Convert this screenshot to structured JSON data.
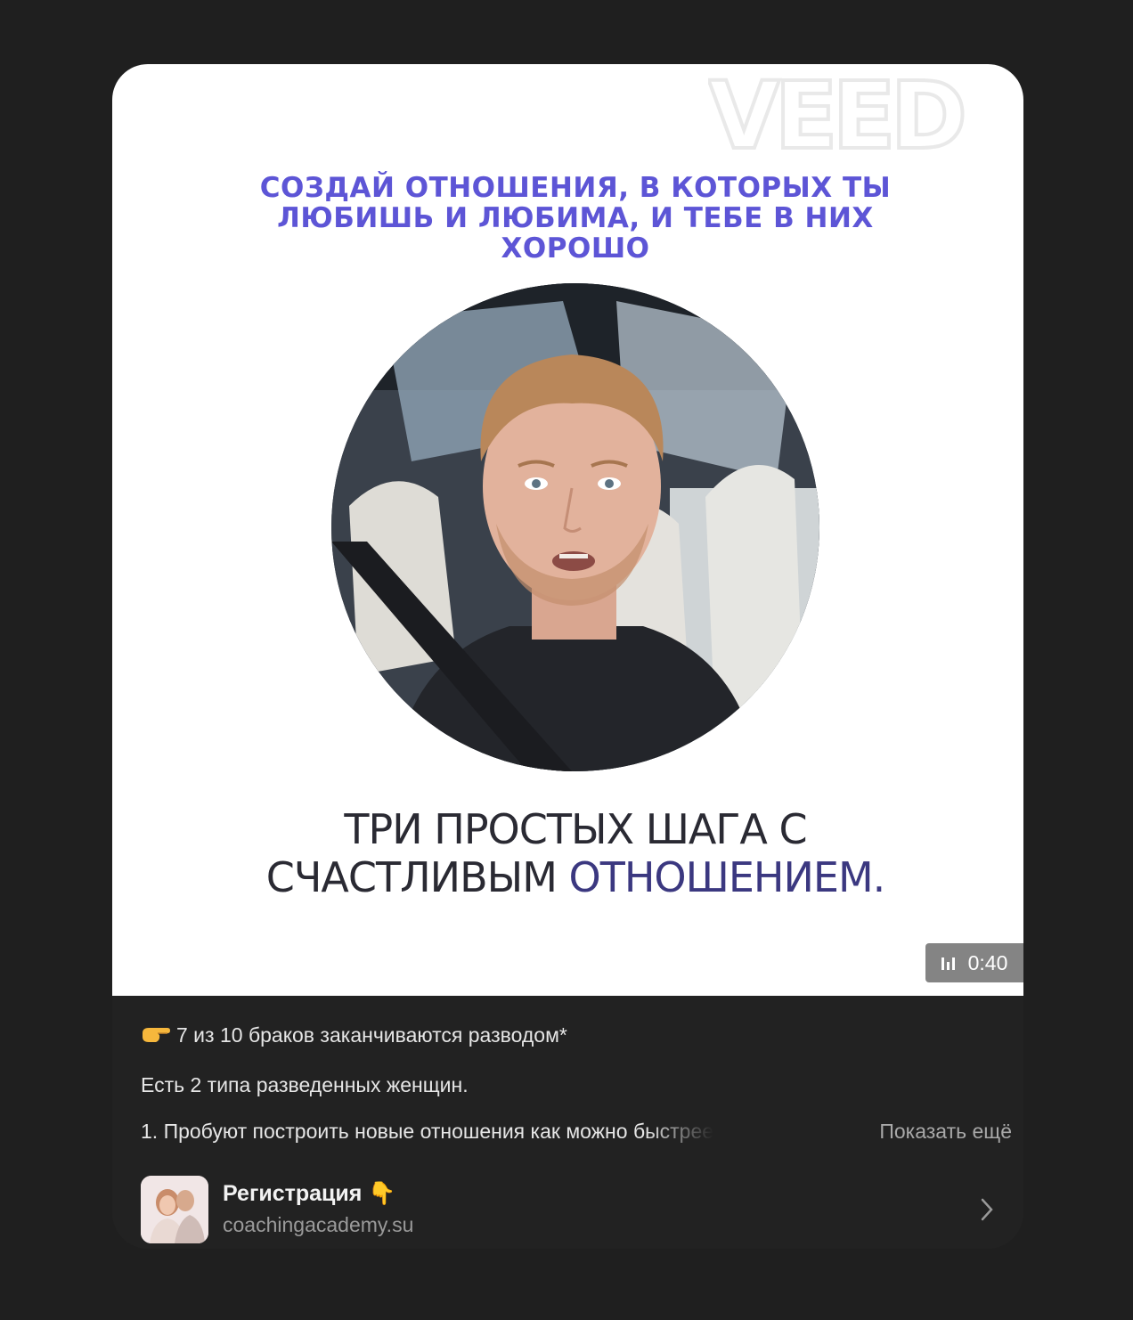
{
  "video": {
    "watermark": "VEED",
    "headline": "СОЗДАЙ ОТНОШЕНИЯ, В КОТОРЫХ ТЫ ЛЮБИШЬ И ЛЮБИМА, И ТЕБЕ В НИХ ХОРОШО",
    "caption_part1": "ТРИ ПРОСТЫХ ШАГА С СЧАСТЛИВЫМ ",
    "caption_part2": "ОТНОШЕНИЕМ.",
    "duration": "0:40"
  },
  "post": {
    "line1_emoji": "👉",
    "line1": "7 из 10 браков заканчиваются разводом*",
    "line2": "Есть 2 типа разведенных женщин.",
    "line3": "1. Пробуют построить новые отношения как можно быстрее",
    "show_more": "Показать ещё"
  },
  "link": {
    "title": "Регистрация 👇",
    "url": "coachingacademy.su"
  },
  "colors": {
    "headline": "#5d55d6",
    "caption_dark": "#2a2a33",
    "caption_accent": "#3b3880",
    "background": "#1f1f1f",
    "card": "#222222"
  }
}
